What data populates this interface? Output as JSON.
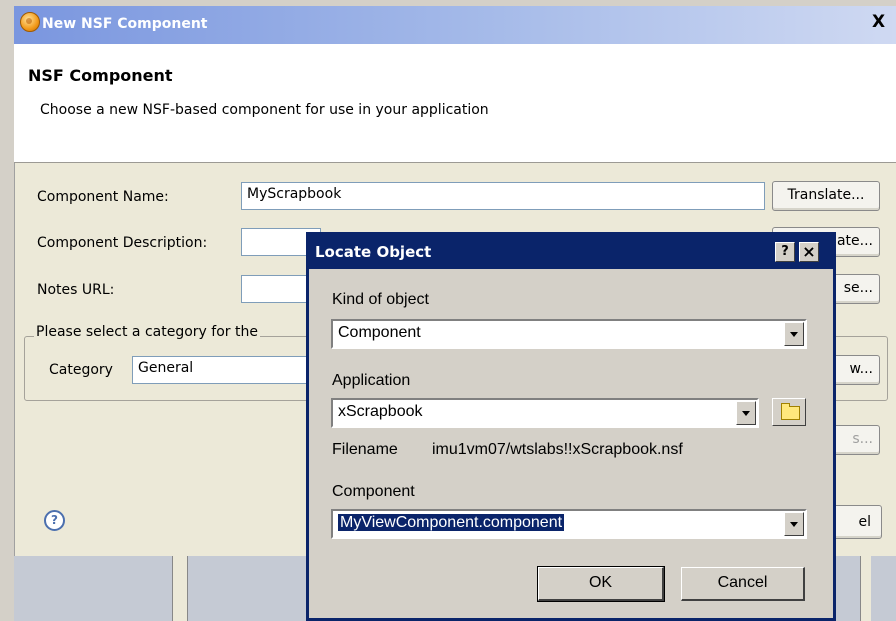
{
  "main_window": {
    "title": "New NSF Component",
    "close_glyph": "X",
    "banner_title": "NSF Component",
    "banner_description": "Choose a new NSF-based component for use in your application",
    "fields": {
      "component_name_label": "Component Name:",
      "component_name_value": "MyScrapbook",
      "component_description_label": "Component Description:",
      "component_description_value": "",
      "notes_url_label": "Notes URL:",
      "notes_url_value": ""
    },
    "translate_button_1": "Translate...",
    "translate_button_2_partial": "ate...",
    "browse_button_partial": "se...",
    "category_group_legend_partial": "Please select a category for the",
    "category_label": "Category",
    "category_value": "General",
    "new_button_partial": "w...",
    "disabled_button_partial": "s...",
    "cancel_button_partial": "el",
    "help_glyph": "?"
  },
  "dialog": {
    "title": "Locate Object",
    "help_glyph": "?",
    "close_glyph": "×",
    "kind_label": "Kind of object",
    "kind_value": "Component",
    "application_label": "Application",
    "application_value": "xScrapbook",
    "filename_label": "Filename",
    "filename_value": "imu1vm07/wtslabs!!xScrapbook.nsf",
    "component_label": "Component",
    "component_value": "MyViewComponent.component",
    "ok_label": "OK",
    "cancel_label": "Cancel"
  }
}
